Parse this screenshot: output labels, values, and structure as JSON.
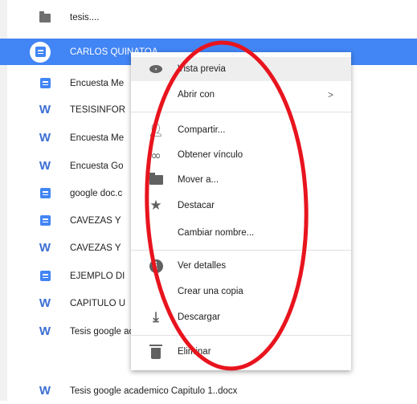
{
  "files": [
    {
      "name": "tesis....",
      "icon": "folder-icon"
    },
    {
      "name": "CARLOS QUINATOA",
      "icon": "google-doc-icon",
      "selected": true
    },
    {
      "name": "Encuesta Me",
      "icon": "google-doc-icon"
    },
    {
      "name": "TESISINFOR",
      "icon": "word-icon"
    },
    {
      "name": "Encuesta Me",
      "icon": "word-icon"
    },
    {
      "name": "Encuesta Go",
      "icon": "word-icon"
    },
    {
      "name": "google doc.c",
      "icon": "google-doc-icon"
    },
    {
      "name": "CAVEZAS Y",
      "icon": "google-doc-icon"
    },
    {
      "name": "CAVEZAS Y",
      "icon": "word-icon"
    },
    {
      "name": "EJEMPLO DI",
      "icon": "google-doc-icon"
    },
    {
      "name": "CAPITULO U",
      "icon": "word-icon"
    },
    {
      "name": "Tesis google academico Capitulo 1..docx",
      "icon": "word-icon"
    }
  ],
  "word_glyph": "W",
  "context_menu": {
    "items": [
      {
        "label": "Vista previa",
        "icon": "eye-icon"
      },
      {
        "label": "Abrir con",
        "icon": "",
        "submenu_arrow": ">"
      },
      {
        "label": "Compartir...",
        "icon": "person-add-icon"
      },
      {
        "label": "Obtener vínculo",
        "icon": "link-icon"
      },
      {
        "label": "Mover a...",
        "icon": "folder-icon"
      },
      {
        "label": "Destacar",
        "icon": "star-icon"
      },
      {
        "label": "Cambiar nombre...",
        "icon": ""
      },
      {
        "label": "Ver detalles",
        "icon": "info-icon"
      },
      {
        "label": "Crear una copia",
        "icon": ""
      },
      {
        "label": "Descargar",
        "icon": "download-icon"
      },
      {
        "label": "Eliminar",
        "icon": "trash-icon"
      }
    ]
  },
  "colors": {
    "selection": "#4285f4",
    "annotation": "#e8141e",
    "doc_blue": "#4285f4",
    "word_blue": "#3c6fd3"
  }
}
